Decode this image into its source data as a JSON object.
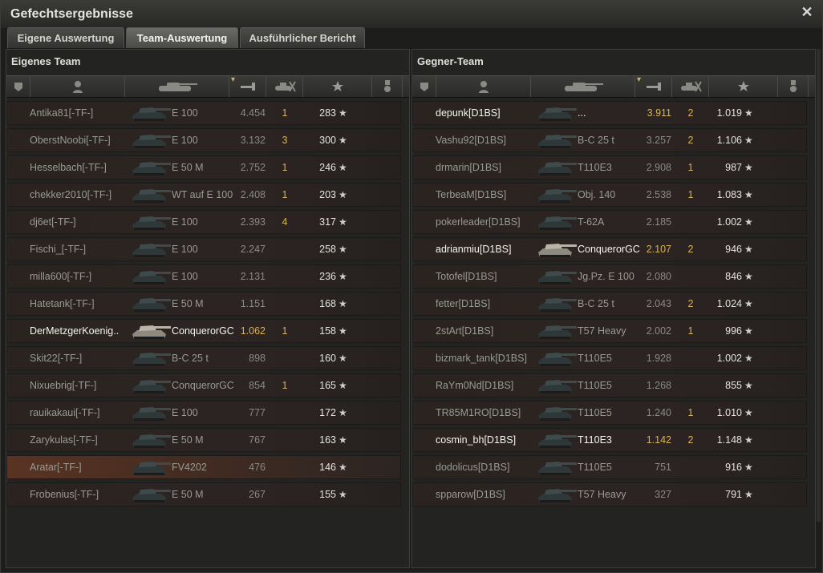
{
  "window": {
    "title": "Gefechtsergebnisse"
  },
  "tabs": [
    {
      "label": "Eigene Auswertung",
      "active": false
    },
    {
      "label": "Team-Auswertung",
      "active": true
    },
    {
      "label": "Ausführlicher Bericht",
      "active": false
    }
  ],
  "teams": [
    {
      "title": "Eigenes Team",
      "columns": [
        "platoon-icon",
        "player-icon",
        "tank-icon",
        "damage-icon",
        "kills-icon",
        "xp-star-icon",
        "medal-icon"
      ],
      "rows": [
        {
          "name": "Antika81[-TF-]",
          "tank": "E 100",
          "damage": "4.454",
          "kills": "1",
          "xp": "283",
          "self": false,
          "highlight": false
        },
        {
          "name": "OberstNoobi[-TF-]",
          "tank": "E 100",
          "damage": "3.132",
          "kills": "3",
          "xp": "300",
          "self": false,
          "highlight": false
        },
        {
          "name": "Hesselbach[-TF-]",
          "tank": "E 50 M",
          "damage": "2.752",
          "kills": "1",
          "xp": "246",
          "self": false,
          "highlight": false
        },
        {
          "name": "chekker2010[-TF-]",
          "tank": "WT auf E 100",
          "damage": "2.408",
          "kills": "1",
          "xp": "203",
          "self": false,
          "highlight": false
        },
        {
          "name": "dj6et[-TF-]",
          "tank": "E 100",
          "damage": "2.393",
          "kills": "4",
          "xp": "317",
          "self": false,
          "highlight": false
        },
        {
          "name": "Fischi_[-TF-]",
          "tank": "E 100",
          "damage": "2.247",
          "kills": "",
          "xp": "258",
          "self": false,
          "highlight": false
        },
        {
          "name": "milla600[-TF-]",
          "tank": "E 100",
          "damage": "2.131",
          "kills": "",
          "xp": "236",
          "self": false,
          "highlight": false
        },
        {
          "name": "Hatetank[-TF-]",
          "tank": "E 50 M",
          "damage": "1.151",
          "kills": "",
          "xp": "168",
          "self": false,
          "highlight": false
        },
        {
          "name": "DerMetzgerKoenig..",
          "tank": "ConquerorGC",
          "damage": "1.062",
          "kills": "1",
          "xp": "158",
          "self": true,
          "highlight": false
        },
        {
          "name": "Skit22[-TF-]",
          "tank": "B-C 25 t",
          "damage": "898",
          "kills": "",
          "xp": "160",
          "self": false,
          "highlight": false
        },
        {
          "name": "Nixuebrig[-TF-]",
          "tank": "ConquerorGC",
          "damage": "854",
          "kills": "1",
          "xp": "165",
          "self": false,
          "highlight": false
        },
        {
          "name": "rauikakaui[-TF-]",
          "tank": "E 100",
          "damage": "777",
          "kills": "",
          "xp": "172",
          "self": false,
          "highlight": false
        },
        {
          "name": "Zarykulas[-TF-]",
          "tank": "E 50 M",
          "damage": "767",
          "kills": "",
          "xp": "163",
          "self": false,
          "highlight": false
        },
        {
          "name": "Aratar[-TF-]",
          "tank": "FV4202",
          "damage": "476",
          "kills": "",
          "xp": "146",
          "self": false,
          "highlight": true
        },
        {
          "name": "Frobenius[-TF-]",
          "tank": "E 50 M",
          "damage": "267",
          "kills": "",
          "xp": "155",
          "self": false,
          "highlight": false
        }
      ]
    },
    {
      "title": "Gegner-Team",
      "columns": [
        "platoon-icon",
        "player-icon",
        "tank-icon",
        "damage-icon",
        "kills-icon",
        "xp-star-icon",
        "medal-icon"
      ],
      "rows": [
        {
          "name": "depunk[D1BS]",
          "tank": "...",
          "damage": "3.911",
          "kills": "2",
          "xp": "1.019",
          "self": true,
          "highlight": false
        },
        {
          "name": "Vashu92[D1BS]",
          "tank": "B-C 25 t",
          "damage": "3.257",
          "kills": "2",
          "xp": "1.106",
          "self": false,
          "highlight": false
        },
        {
          "name": "drmarin[D1BS]",
          "tank": "T110E3",
          "damage": "2.908",
          "kills": "1",
          "xp": "987",
          "self": false,
          "highlight": false
        },
        {
          "name": "TerbeaM[D1BS]",
          "tank": "Obj. 140",
          "damage": "2.538",
          "kills": "1",
          "xp": "1.083",
          "self": false,
          "highlight": false
        },
        {
          "name": "pokerleader[D1BS]",
          "tank": "T-62A",
          "damage": "2.185",
          "kills": "",
          "xp": "1.002",
          "self": false,
          "highlight": false
        },
        {
          "name": "adrianmiu[D1BS]",
          "tank": "ConquerorGC",
          "damage": "2.107",
          "kills": "2",
          "xp": "946",
          "self": true,
          "highlight": false
        },
        {
          "name": "Totofel[D1BS]",
          "tank": "Jg.Pz. E 100",
          "damage": "2.080",
          "kills": "",
          "xp": "846",
          "self": false,
          "highlight": false
        },
        {
          "name": "fetter[D1BS]",
          "tank": "B-C 25 t",
          "damage": "2.043",
          "kills": "2",
          "xp": "1.024",
          "self": false,
          "highlight": false
        },
        {
          "name": "2stArt[D1BS]",
          "tank": "T57 Heavy",
          "damage": "2.002",
          "kills": "1",
          "xp": "996",
          "self": false,
          "highlight": false
        },
        {
          "name": "bizmark_tank[D1BS]",
          "tank": "T110E5",
          "damage": "1.928",
          "kills": "",
          "xp": "1.002",
          "self": false,
          "highlight": false
        },
        {
          "name": "RaYm0Nd[D1BS]",
          "tank": "T110E5",
          "damage": "1.268",
          "kills": "",
          "xp": "855",
          "self": false,
          "highlight": false
        },
        {
          "name": "TR85M1RO[D1BS]",
          "tank": "T110E5",
          "damage": "1.240",
          "kills": "1",
          "xp": "1.010",
          "self": false,
          "highlight": false
        },
        {
          "name": "cosmin_bh[D1BS]",
          "tank": "T110E3",
          "damage": "1.142",
          "kills": "2",
          "xp": "1.148",
          "self": true,
          "highlight": false
        },
        {
          "name": "dodolicus[D1BS]",
          "tank": "T110E5",
          "damage": "751",
          "kills": "",
          "xp": "916",
          "self": false,
          "highlight": false
        },
        {
          "name": "spparow[D1BS]",
          "tank": "T57 Heavy",
          "damage": "327",
          "kills": "",
          "xp": "791",
          "self": false,
          "highlight": false
        }
      ]
    }
  ],
  "icons": {
    "star": "★",
    "close": "✕"
  },
  "colors": {
    "gold": "#d6b35a",
    "highlight_row": "#5a3322"
  }
}
